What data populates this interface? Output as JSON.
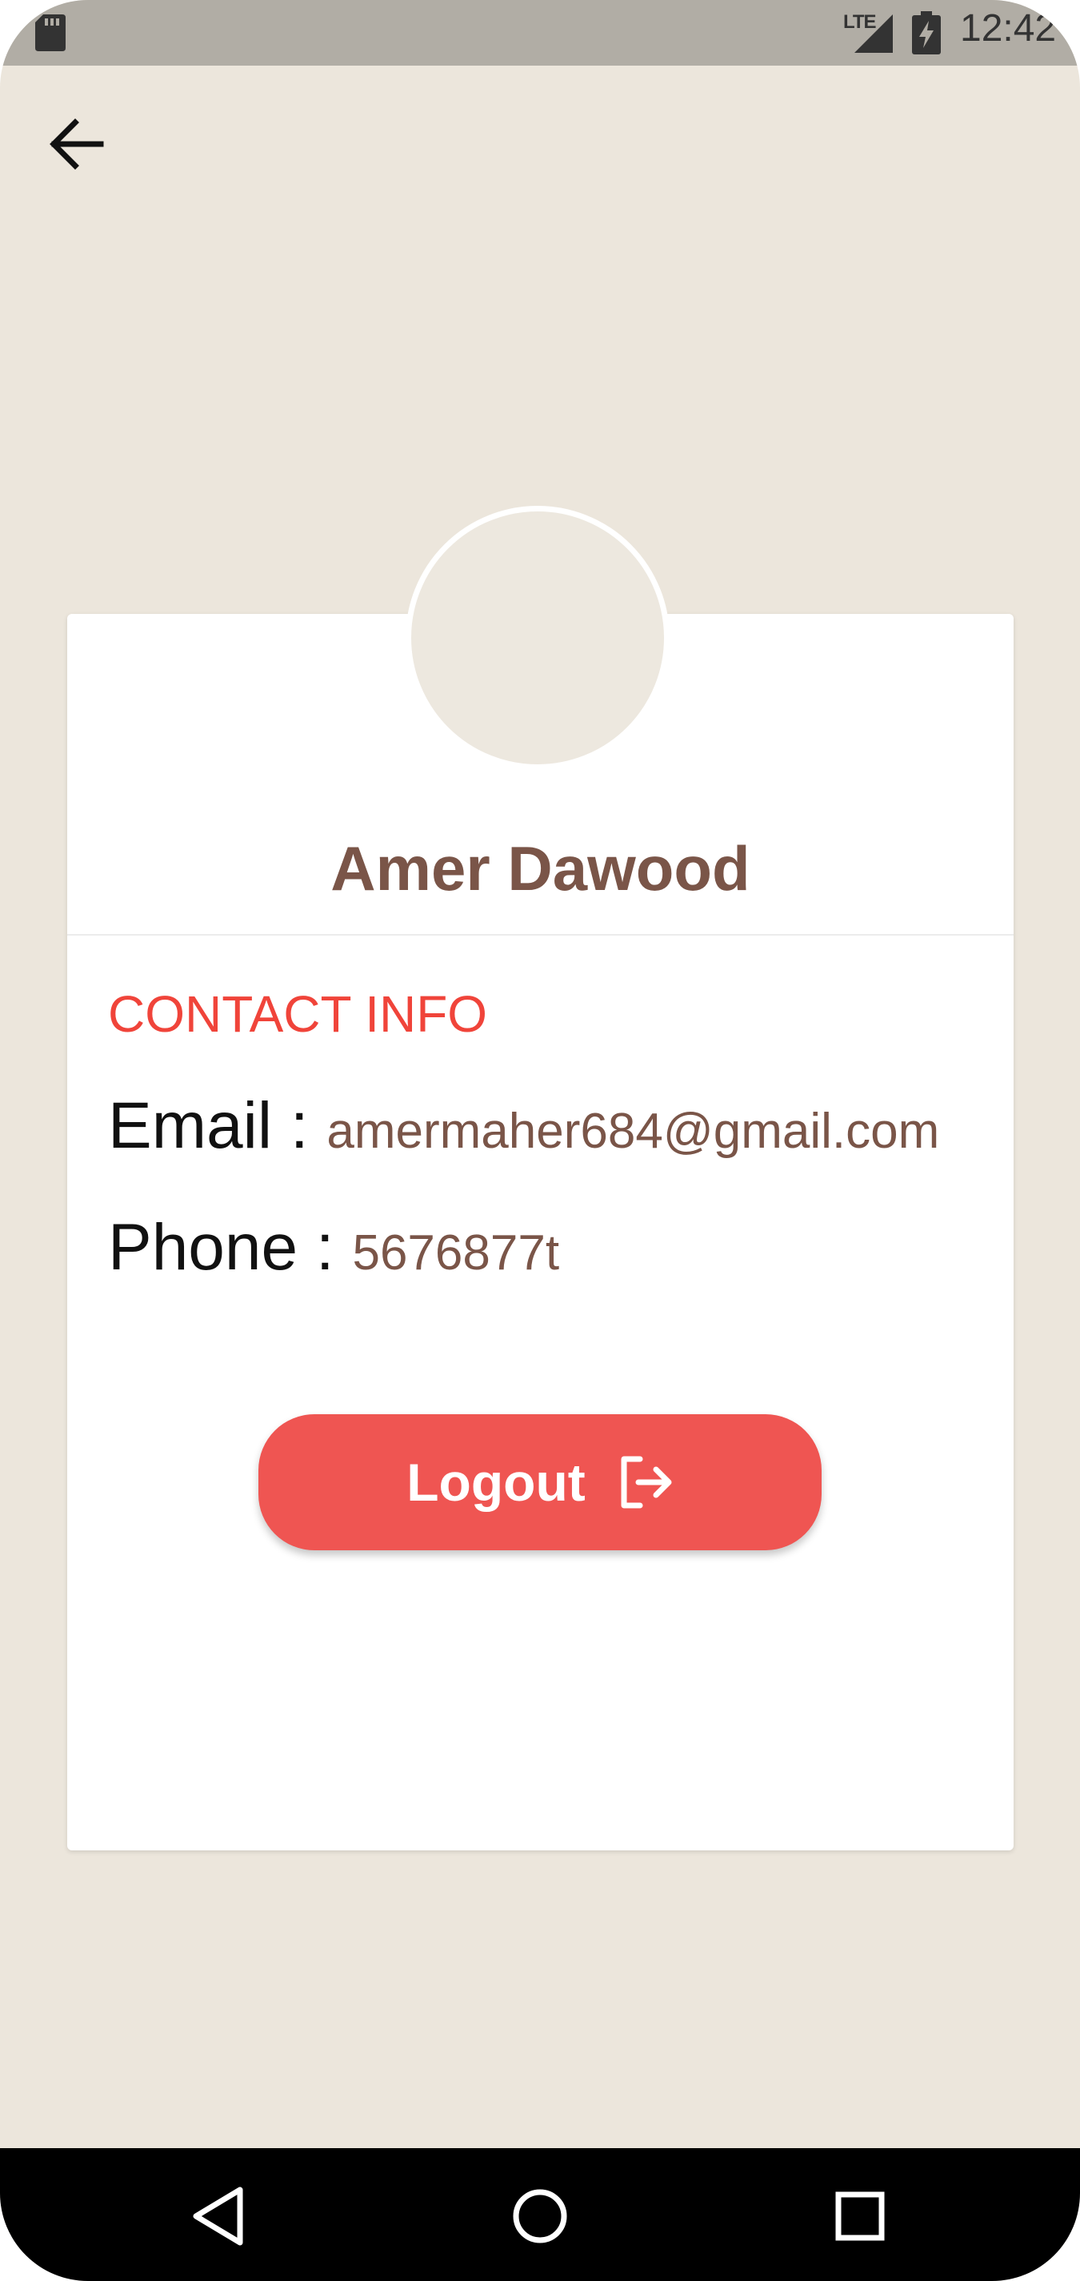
{
  "status_bar": {
    "network": "LTE",
    "time": "12:42"
  },
  "header": {
    "back_icon": "arrow-left-icon"
  },
  "profile": {
    "name": "Amer Dawood",
    "avatar_color": "#EDE8DF"
  },
  "contact": {
    "heading": "CONTACT INFO",
    "email_label": "Email : ",
    "email_value": "amermaher684@gmail.com",
    "phone_label": "Phone : ",
    "phone_value": "5676877t"
  },
  "actions": {
    "logout_label": "Logout",
    "logout_icon": "logout-icon"
  },
  "nav": {
    "back_icon": "triangle-back-icon",
    "home_icon": "circle-home-icon",
    "recents_icon": "square-recents-icon"
  },
  "colors": {
    "background": "#ECE6DC",
    "accent_red": "#EF5552",
    "heading_red": "#F0443A",
    "name_brown": "#7A5548",
    "status_bar": "#B1ADA5"
  }
}
